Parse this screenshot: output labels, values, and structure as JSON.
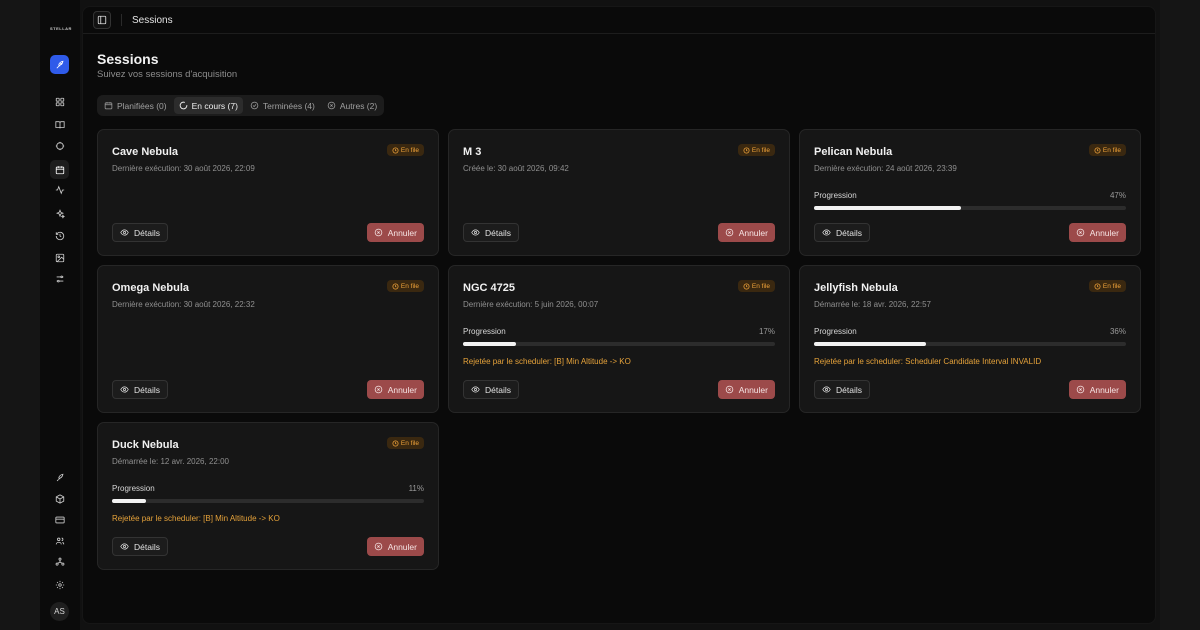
{
  "app": {
    "logo_text": "STELLAR"
  },
  "sidebar": {
    "nav": [
      {
        "name": "launch",
        "icon": "rocket-icon"
      },
      {
        "name": "dashboard",
        "icon": "grid-icon"
      },
      {
        "name": "catalog",
        "icon": "book-icon"
      },
      {
        "name": "targets",
        "icon": "crosshair-icon"
      },
      {
        "name": "sessions",
        "icon": "calendar-icon",
        "active": true
      },
      {
        "name": "activity",
        "icon": "activity-icon"
      },
      {
        "name": "objects",
        "icon": "sparkles-icon"
      },
      {
        "name": "history",
        "icon": "history-icon"
      },
      {
        "name": "images",
        "icon": "image-icon"
      },
      {
        "name": "settings-sliders",
        "icon": "sliders-icon"
      }
    ],
    "bottom": [
      {
        "name": "launch-secondary",
        "icon": "rocket-icon"
      },
      {
        "name": "equipment",
        "icon": "box-icon"
      },
      {
        "name": "billing",
        "icon": "credit-card-icon"
      },
      {
        "name": "users",
        "icon": "users-icon"
      },
      {
        "name": "organization",
        "icon": "network-icon"
      },
      {
        "name": "settings",
        "icon": "gear-icon"
      }
    ],
    "avatar_initials": "AS"
  },
  "topbar": {
    "title": "Sessions"
  },
  "page": {
    "title": "Sessions",
    "subtitle": "Suivez vos sessions d'acquisition"
  },
  "tabs": [
    {
      "label": "Planifiées (0)",
      "icon": "calendar-icon",
      "active": false
    },
    {
      "label": "En cours (7)",
      "icon": "loader-icon",
      "active": true
    },
    {
      "label": "Terminées (4)",
      "icon": "check-circle-icon",
      "active": false
    },
    {
      "label": "Autres (2)",
      "icon": "x-circle-icon",
      "active": false
    }
  ],
  "labels": {
    "progress": "Progression",
    "details": "Détails",
    "cancel": "Annuler"
  },
  "colors": {
    "primary": "#2f5bea",
    "badge_text": "#f0a33a",
    "badge_bg": "#3a2810",
    "cancel_bg": "#9c4a4a",
    "reject_text": "#e5a23a"
  },
  "cards": [
    {
      "name": "Cave Nebula",
      "status": "En file",
      "subtitle": "Dernière exécution: 30 août 2026, 22:09",
      "progress": null,
      "progress_label": "",
      "reject": ""
    },
    {
      "name": "M 3",
      "status": "En file",
      "subtitle": "Créée le: 30 août 2026, 09:42",
      "progress": null,
      "progress_label": "",
      "reject": ""
    },
    {
      "name": "Pelican Nebula",
      "status": "En file",
      "subtitle": "Dernière exécution: 24 août 2026, 23:39",
      "progress": 47,
      "progress_label": "47%",
      "reject": ""
    },
    {
      "name": "Omega Nebula",
      "status": "En file",
      "subtitle": "Dernière exécution: 30 août 2026, 22:32",
      "progress": null,
      "progress_label": "",
      "reject": ""
    },
    {
      "name": "NGC 4725",
      "status": "En file",
      "subtitle": "Dernière exécution: 5 juin 2026, 00:07",
      "progress": 17,
      "progress_label": "17%",
      "reject": "Rejetée par le scheduler: [B] Min Altitude -> KO"
    },
    {
      "name": "Jellyfish Nebula",
      "status": "En file",
      "subtitle": "Démarrée le: 18 avr. 2026, 22:57",
      "progress": 36,
      "progress_label": "36%",
      "reject": "Rejetée par le scheduler: Scheduler Candidate Interval INVALID"
    },
    {
      "name": "Duck Nebula",
      "status": "En file",
      "subtitle": "Démarrée le: 12 avr. 2026, 22:00",
      "progress": 11,
      "progress_label": "11%",
      "reject": "Rejetée par le scheduler: [B] Min Altitude -> KO"
    }
  ]
}
